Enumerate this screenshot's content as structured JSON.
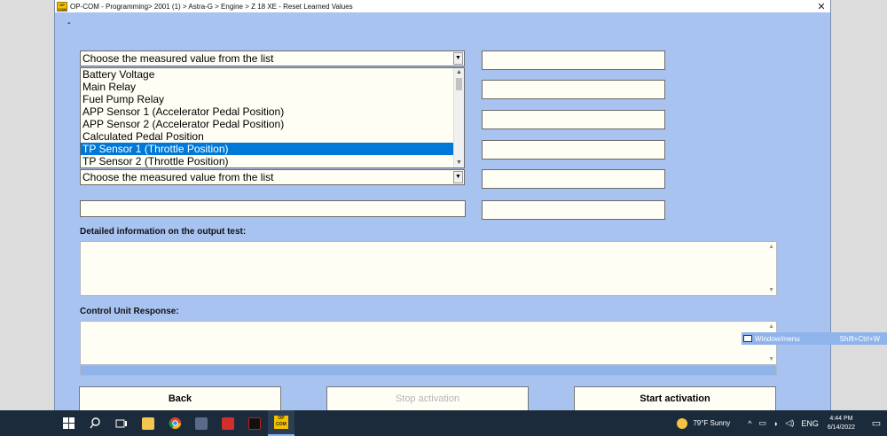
{
  "window": {
    "logo_text": "OP COM",
    "title": "OP-COM - Programming> 2001 (1) > Astra-G > Engine > Z 18 XE - Reset Learned Values",
    "close_symbol": "✕",
    "dash": "-"
  },
  "combo1": {
    "value": "Choose the measured value from the list",
    "arrow": "▼"
  },
  "combo2": {
    "value": "Choose the measured value from the list",
    "arrow": "▼"
  },
  "list": {
    "items": [
      "Battery Voltage",
      "Main Relay",
      "Fuel Pump Relay",
      "APP Sensor 1 (Accelerator Pedal Position)",
      "APP Sensor 2 (Accelerator Pedal Position)",
      "Calculated Pedal Position",
      "TP Sensor 1 (Throttle Position)",
      "TP Sensor 2 (Throttle Position)"
    ],
    "selected_index": 6,
    "scroll_up": "▲",
    "scroll_down": "▼"
  },
  "labels": {
    "detailed_info": "Detailed information on the output test:",
    "control_unit_response": "Control Unit Response:"
  },
  "buttons": {
    "back": "Back",
    "stop": "Stop activation",
    "start": "Start activation"
  },
  "hint": {
    "label": "Window/menu",
    "shortcut": "Shift+Ctrl+W"
  },
  "taskbar": {
    "apps": [
      "start-icon",
      "search-icon",
      "task-view-icon",
      "file-explorer-icon",
      "chrome-icon",
      "app-icon",
      "app-red-icon",
      "app-black-icon",
      "opcom-icon"
    ],
    "opcom_text": "OP COM",
    "weather": "79°F  Sunny",
    "language": "ENG",
    "time": "4:44 PM",
    "date": "6/14/2022",
    "chevron": "^"
  },
  "colors": {
    "window_bg": "#a9c3f1",
    "selection": "#0078d7",
    "taskbar": "#1b2b3b"
  }
}
